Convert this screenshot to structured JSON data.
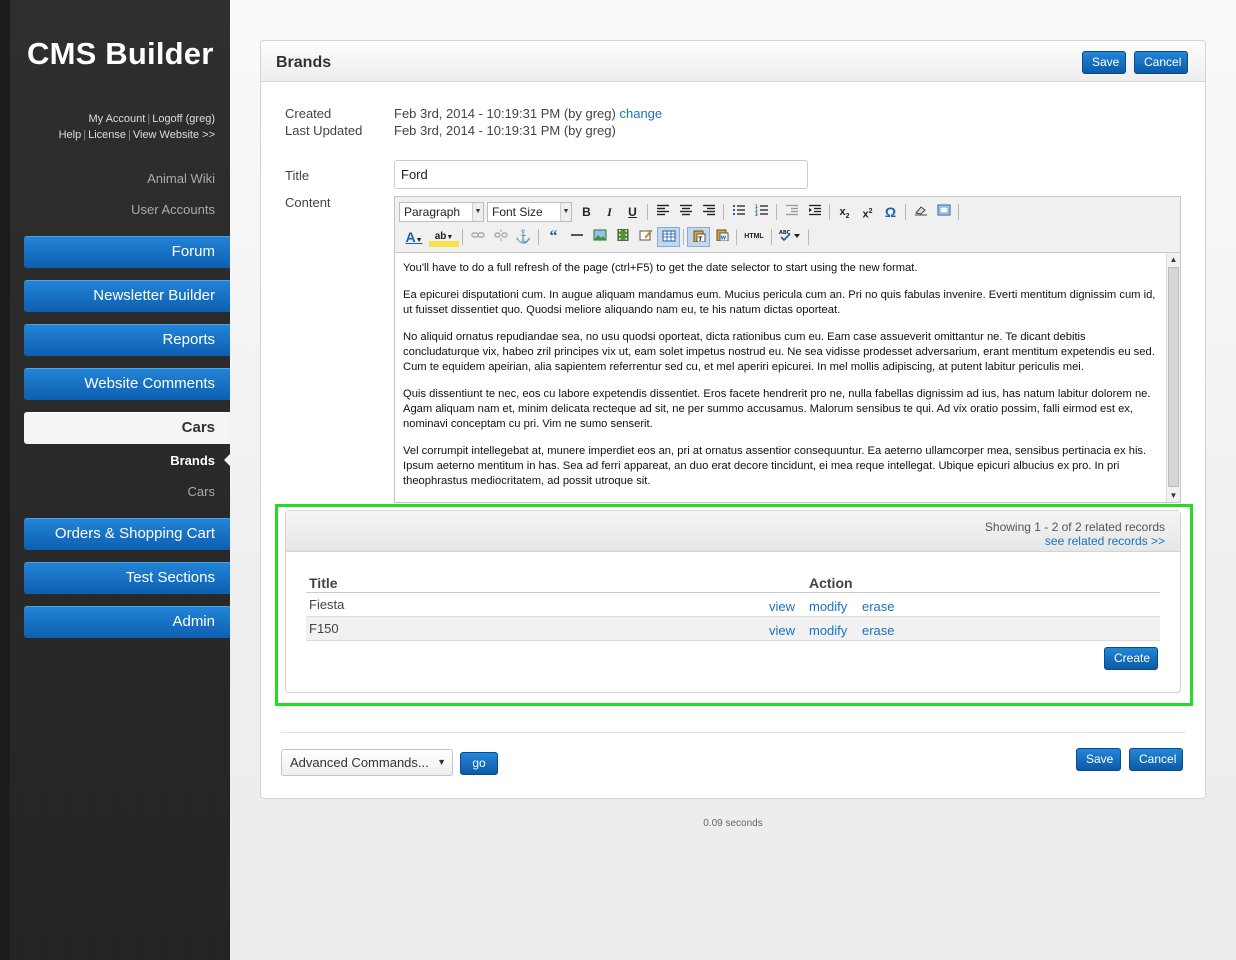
{
  "app": {
    "title": "CMS Builder",
    "user_links_line1": {
      "my_account": "My Account",
      "logoff": "Logoff (greg)"
    },
    "user_links_line2": {
      "help": "Help",
      "license": "License",
      "view_website": "View Website >>"
    },
    "separator": "|"
  },
  "sidebar": {
    "plain_links": [
      "Animal Wiki",
      "User Accounts"
    ],
    "nav": [
      {
        "label": "Forum"
      },
      {
        "label": "Newsletter Builder"
      },
      {
        "label": "Reports"
      },
      {
        "label": "Website Comments"
      },
      {
        "label": "Cars",
        "active": true
      },
      {
        "label": "Orders & Shopping Cart"
      },
      {
        "label": "Test Sections"
      },
      {
        "label": "Admin"
      }
    ],
    "sub_items": [
      {
        "label": "Brands",
        "current": true
      },
      {
        "label": "Cars"
      }
    ]
  },
  "panel": {
    "title": "Brands",
    "save_label": "Save",
    "cancel_label": "Cancel"
  },
  "meta": {
    "created_label": "Created",
    "created_value": "Feb 3rd, 2014 - 10:19:31 PM (by greg)",
    "change_link": "change",
    "updated_label": "Last Updated",
    "updated_value": "Feb 3rd, 2014 - 10:19:31 PM (by greg)"
  },
  "form": {
    "title_label": "Title",
    "title_value": "Ford",
    "content_label": "Content"
  },
  "editor": {
    "format_select": "Paragraph",
    "font_size_select": "Font Size",
    "toolbar_icons": [
      "bold-icon",
      "italic-icon",
      "underline-icon",
      "align-left-icon",
      "align-center-icon",
      "align-right-icon",
      "bullet-list-icon",
      "numbered-list-icon",
      "outdent-icon",
      "indent-icon",
      "subscript-icon",
      "superscript-icon",
      "omega-icon",
      "eraser-icon",
      "fullscreen-icon"
    ],
    "paragraphs": [
      "You'll have to do a full refresh of the page (ctrl+F5) to get the date selector to start using the new format.",
      "Ea epicurei disputationi cum. In augue aliquam mandamus eum. Mucius pericula cum an. Pri no quis fabulas invenire. Everti mentitum dignissim cum id, ut fuisset dissentiet quo. Quodsi meliore aliquando nam eu, te his natum dictas oporteat.",
      "No aliquid ornatus repudiandae sea, no usu quodsi oporteat, dicta rationibus cum eu. Eam case assueverit omittantur ne. Te dicant debitis concludaturque vix, habeo zril principes vix ut, eam solet impetus nostrud eu. Ne sea vidisse prodesset adversarium, erant mentitum expetendis eu sed. Cum te equidem apeirian, alia sapientem referrentur sed cu, et mel aperiri epicurei. In mel mollis adipiscing, at putent labitur periculis mei.",
      "Quis dissentiunt te nec, eos cu labore expetendis dissentiet. Eros facete hendrerit pro ne, nulla fabellas dignissim ad ius, has natum labitur dolorem ne. Agam aliquam nam et, minim delicata recteque ad sit, ne per summo accusamus. Malorum sensibus te qui. Ad vix oratio possim, falli eirmod est ex, nominavi conceptam cu pri. Vim ne sumo senserit.",
      "Vel corrumpit intellegebat at, munere imperdiet eos an, pri at ornatus assentior consequuntur. Ea aeterno ullamcorper mea, sensibus pertinacia ex his. Ipsum aeterno mentitum in has. Sea ad ferri appareat, an duo erat decore tincidunt, ei mea reque intellegat. Ubique epicuri albucius ex pro. In pri theophrastus mediocritatem, ad possit utroque sit."
    ]
  },
  "related": {
    "showing": "Showing 1 - 2 of 2 related records",
    "see_related": "see related records >>",
    "col_title": "Title",
    "col_action": "Action",
    "rows": [
      {
        "title": "Fiesta",
        "view": "view",
        "modify": "modify",
        "erase": "erase"
      },
      {
        "title": "F150",
        "view": "view",
        "modify": "modify",
        "erase": "erase"
      }
    ],
    "create_label": "Create"
  },
  "footer": {
    "advanced_commands": "Advanced Commands...",
    "go_label": "go",
    "save_label": "Save",
    "cancel_label": "Cancel",
    "timing": "0.09 seconds"
  },
  "colors": {
    "accent_blue": "#1a72c4",
    "button_blue": "#0b5aa6",
    "highlight_green": "#22dd22",
    "sidebar_bg": "#2a2a2a"
  }
}
